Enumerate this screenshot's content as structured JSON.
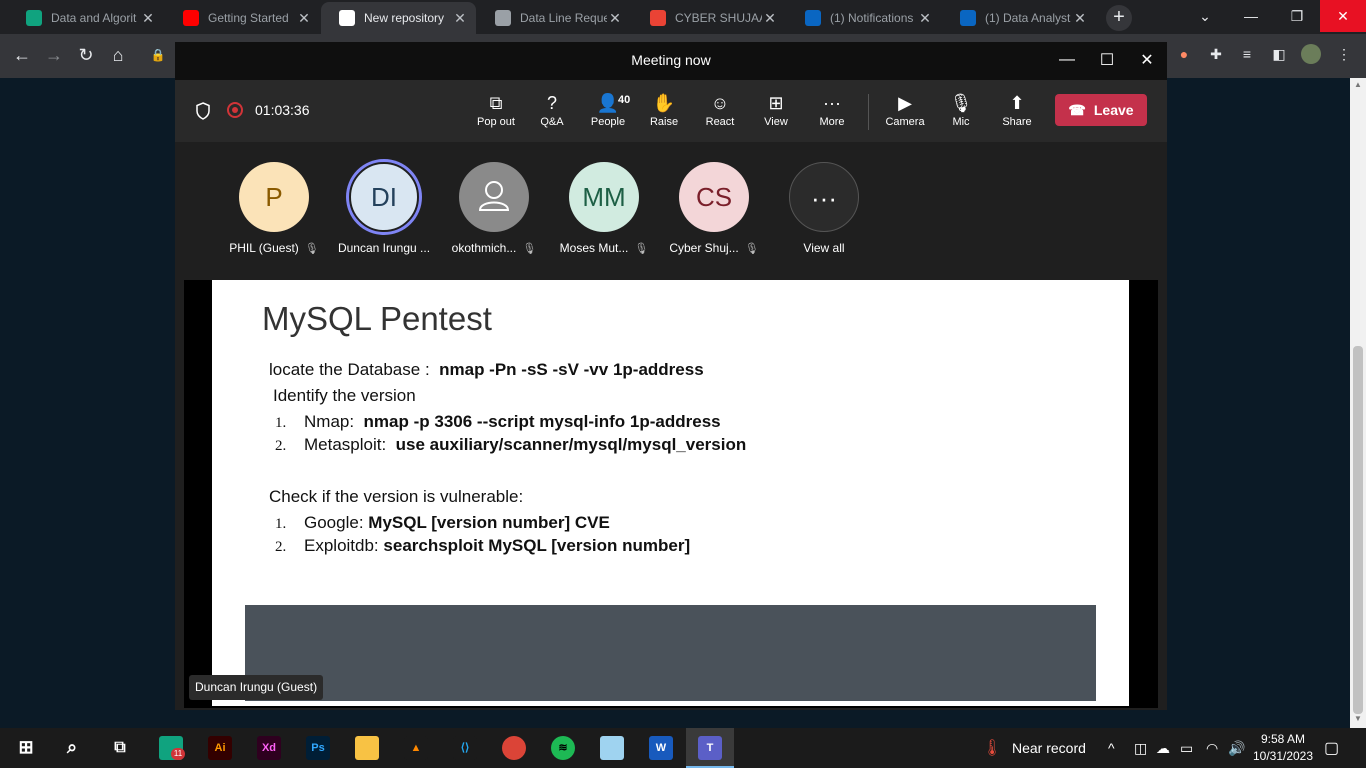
{
  "browser": {
    "tabs": [
      {
        "title": "Data and Algorit",
        "icon": "openai-icon",
        "color": "#10a37f"
      },
      {
        "title": "Getting Started",
        "icon": "youtube-icon",
        "color": "#ff0000"
      },
      {
        "title": "New repository",
        "icon": "github-icon",
        "color": "#ffffff",
        "active": true
      },
      {
        "title": "Data Line Reque",
        "icon": "globe-icon",
        "color": "#9aa0a6"
      },
      {
        "title": "CYBER SHUJAA",
        "icon": "gmail-icon",
        "color": "#ea4335"
      },
      {
        "title": "(1) Notifications",
        "icon": "linkedin-icon",
        "color": "#0a66c2"
      },
      {
        "title": "(1) Data Analyst",
        "icon": "linkedin-icon",
        "color": "#0a66c2"
      }
    ],
    "tab_close_glyph": "✕",
    "new_tab_glyph": "+"
  },
  "meeting": {
    "title": "Meeting now",
    "timer": "01:03:36",
    "controls": [
      {
        "label": "Pop out",
        "icon": "pop-out-icon",
        "glyph": "⧉"
      },
      {
        "label": "Q&A",
        "icon": "qa-icon",
        "glyph": "?"
      },
      {
        "label": "People",
        "icon": "people-icon",
        "glyph": "👤",
        "count": "40"
      },
      {
        "label": "Raise",
        "icon": "raise-hand-icon",
        "glyph": "✋"
      },
      {
        "label": "React",
        "icon": "react-icon",
        "glyph": "☺"
      },
      {
        "label": "View",
        "icon": "view-icon",
        "glyph": "⊞"
      },
      {
        "label": "More",
        "icon": "more-icon",
        "glyph": "···"
      },
      {
        "label": "Camera",
        "icon": "camera-off-icon",
        "glyph": "▶"
      },
      {
        "label": "Mic",
        "icon": "mic-off-icon",
        "glyph": "🎙"
      },
      {
        "label": "Share",
        "icon": "share-icon",
        "glyph": "⬆"
      }
    ],
    "leave_label": "Leave",
    "participants": [
      {
        "initials": "P",
        "name": "PHIL (Guest)",
        "bg": "#fbe3b8",
        "fg": "#8a5a00"
      },
      {
        "initials": "DI",
        "name": "Duncan Irungu ...",
        "bg": "#d9e6f2",
        "fg": "#24415c",
        "speaking": true
      },
      {
        "initials": "",
        "name": "okothmich...",
        "bg": "#8a8a8a",
        "fg": "#ffffff"
      },
      {
        "initials": "MM",
        "name": "Moses Mut...",
        "bg": "#d1ebe0",
        "fg": "#1d5f45"
      },
      {
        "initials": "CS",
        "name": "Cyber Shuj...",
        "bg": "#f3d6d8",
        "fg": "#7a1f2a"
      },
      {
        "initials": "···",
        "name": "View all",
        "bg": "#2b2b2b",
        "fg": "#ffffff"
      }
    ],
    "speaker_tag": "Duncan Irungu (Guest)"
  },
  "slide": {
    "title": "MySQL Pentest",
    "locate_label": "locate the Database :",
    "locate_cmd": "nmap -Pn -sS -sV -vv  1p-address",
    "identify_heading": "Identify the version",
    "identify_items": [
      {
        "num": "1.",
        "label": "Nmap:",
        "cmd": "nmap -p 3306 --script mysql-info 1p-address"
      },
      {
        "num": "2.",
        "label": "Metasploit:",
        "cmd": "use auxiliary/scanner/mysql/mysql_version"
      }
    ],
    "check_heading": "Check if the version is vulnerable:",
    "check_items": [
      {
        "num": "1.",
        "label": "Google:",
        "cmd": "MySQL [version number] CVE"
      },
      {
        "num": "2.",
        "label": "Exploitdb:",
        "cmd": "searchsploit MySQL [version number]"
      }
    ]
  },
  "taskbar": {
    "apps": [
      {
        "name": "taskbar-chatgpt",
        "label": "",
        "color": "#10a37f",
        "badge": "11"
      },
      {
        "name": "taskbar-illustrator",
        "label": "Ai",
        "color": "#330000",
        "fg": "#ff9a00"
      },
      {
        "name": "taskbar-xd",
        "label": "Xd",
        "color": "#2e001f",
        "fg": "#ff61f6"
      },
      {
        "name": "taskbar-photoshop",
        "label": "Ps",
        "color": "#001e36",
        "fg": "#31a8ff"
      },
      {
        "name": "taskbar-file-explorer",
        "label": "",
        "color": "#f8c244",
        "fg": "#000"
      },
      {
        "name": "taskbar-vlc",
        "label": "▲",
        "color": "#1b1b1b",
        "fg": "#ff8800"
      },
      {
        "name": "taskbar-vscode",
        "label": "⟨⟩",
        "color": "#1b1b1b",
        "fg": "#23a9f2"
      },
      {
        "name": "taskbar-chrome",
        "label": "",
        "color": "#db4437",
        "fg": "#fff"
      },
      {
        "name": "taskbar-spotify",
        "label": "≋",
        "color": "#1db954",
        "fg": "#000"
      },
      {
        "name": "taskbar-app",
        "label": "",
        "color": "#9fd3f0",
        "fg": "#000"
      },
      {
        "name": "taskbar-word",
        "label": "W",
        "color": "#185abd",
        "fg": "#fff"
      },
      {
        "name": "taskbar-teams",
        "label": "T",
        "color": "#5b5fc7",
        "fg": "#fff"
      }
    ],
    "weather": "Near record",
    "time": "9:58 AM",
    "date": "10/31/2023"
  }
}
